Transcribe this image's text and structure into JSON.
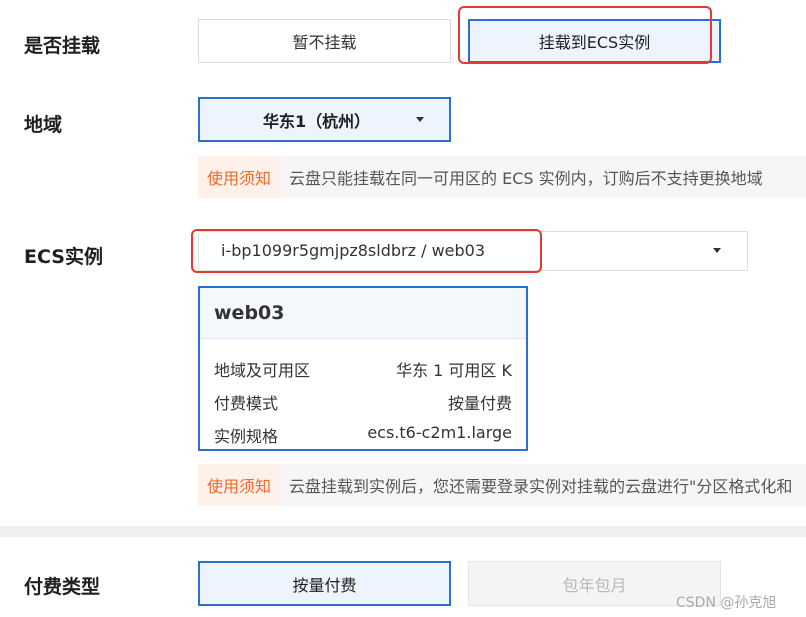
{
  "mount": {
    "label": "是否挂载",
    "options": [
      "暂不挂载",
      "挂载到ECS实例"
    ],
    "selected": "挂载到ECS实例"
  },
  "region": {
    "label": "地域",
    "selected": "华东1（杭州）",
    "notice_tag": "使用须知",
    "notice_text": "云盘只能挂载在同一可用区的 ECS 实例内，订购后不支持更换地域"
  },
  "ecs": {
    "label": "ECS实例",
    "selected": "i-bp1099r5gmjpz8sldbrz / web03",
    "card": {
      "title": "web03",
      "rows": [
        {
          "key": "地域及可用区",
          "value": "华东 1 可用区 K"
        },
        {
          "key": "付费模式",
          "value": "按量付费"
        },
        {
          "key": "实例规格",
          "value": "ecs.t6-c2m1.large"
        }
      ]
    },
    "notice_tag": "使用须知",
    "notice_text": "云盘挂载到实例后，您还需要登录实例对挂载的云盘进行\"分区格式化和"
  },
  "billing": {
    "label": "付费类型",
    "options": [
      "按量付费",
      "包年包月"
    ],
    "selected": "按量付费"
  },
  "watermark": "CSDN @孙克旭",
  "colors": {
    "accent": "#2a6fd6",
    "highlight": "#e53935",
    "notice_tag": "#f06a2b"
  }
}
